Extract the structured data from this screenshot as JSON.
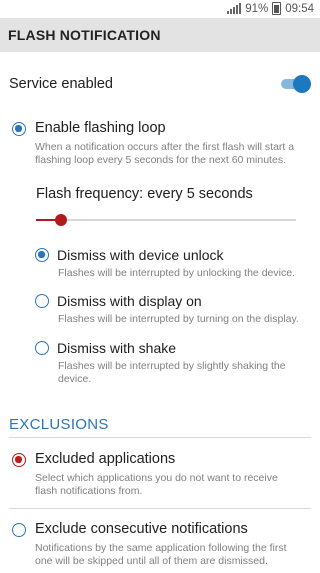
{
  "status_bar": {
    "battery": "91%",
    "time": "09:54",
    "signal_icon": "signal-icon",
    "battery_icon": "battery-icon"
  },
  "header": {
    "title": "FLASH NOTIFICATION"
  },
  "service": {
    "label": "Service enabled",
    "enabled": true
  },
  "loop": {
    "label": "Enable flashing loop",
    "checked": true,
    "description_line1": "When a notification occurs after the first flash will start a",
    "description_line2": "flashing loop every 5 seconds for the next 60 minutes."
  },
  "frequency": {
    "label": "Flash frequency: every 5 seconds",
    "slider_fraction": 0.08
  },
  "dismiss_options": [
    {
      "label": "Dismiss with device unlock",
      "description": "Flashes will be interrupted by unlocking the device.",
      "checked": true
    },
    {
      "label": "Dismiss with display on",
      "description": "Flashes will be interrupted by turning on the display.",
      "checked": false
    },
    {
      "label": "Dismiss with shake",
      "description_line1": "Flashes will be interrupted by slightly shaking the",
      "description_line2": "device.",
      "checked": false
    }
  ],
  "exclusions": {
    "section_title": "EXCLUSIONS",
    "excluded_apps": {
      "label": "Excluded applications",
      "description_line1": "Select which applications you do not want to receive",
      "description_line2": "flash notifications from.",
      "checked": true
    },
    "consecutive": {
      "label": "Exclude consecutive notifications",
      "description_line1": "Notifications by the same application following the first",
      "description_line2": "one will be skipped until all of them are dismissed.",
      "checked": false
    }
  },
  "colors": {
    "accent": "#2a74b8",
    "red_accent": "#b01a1a",
    "header_bg": "#e3e3e3"
  }
}
